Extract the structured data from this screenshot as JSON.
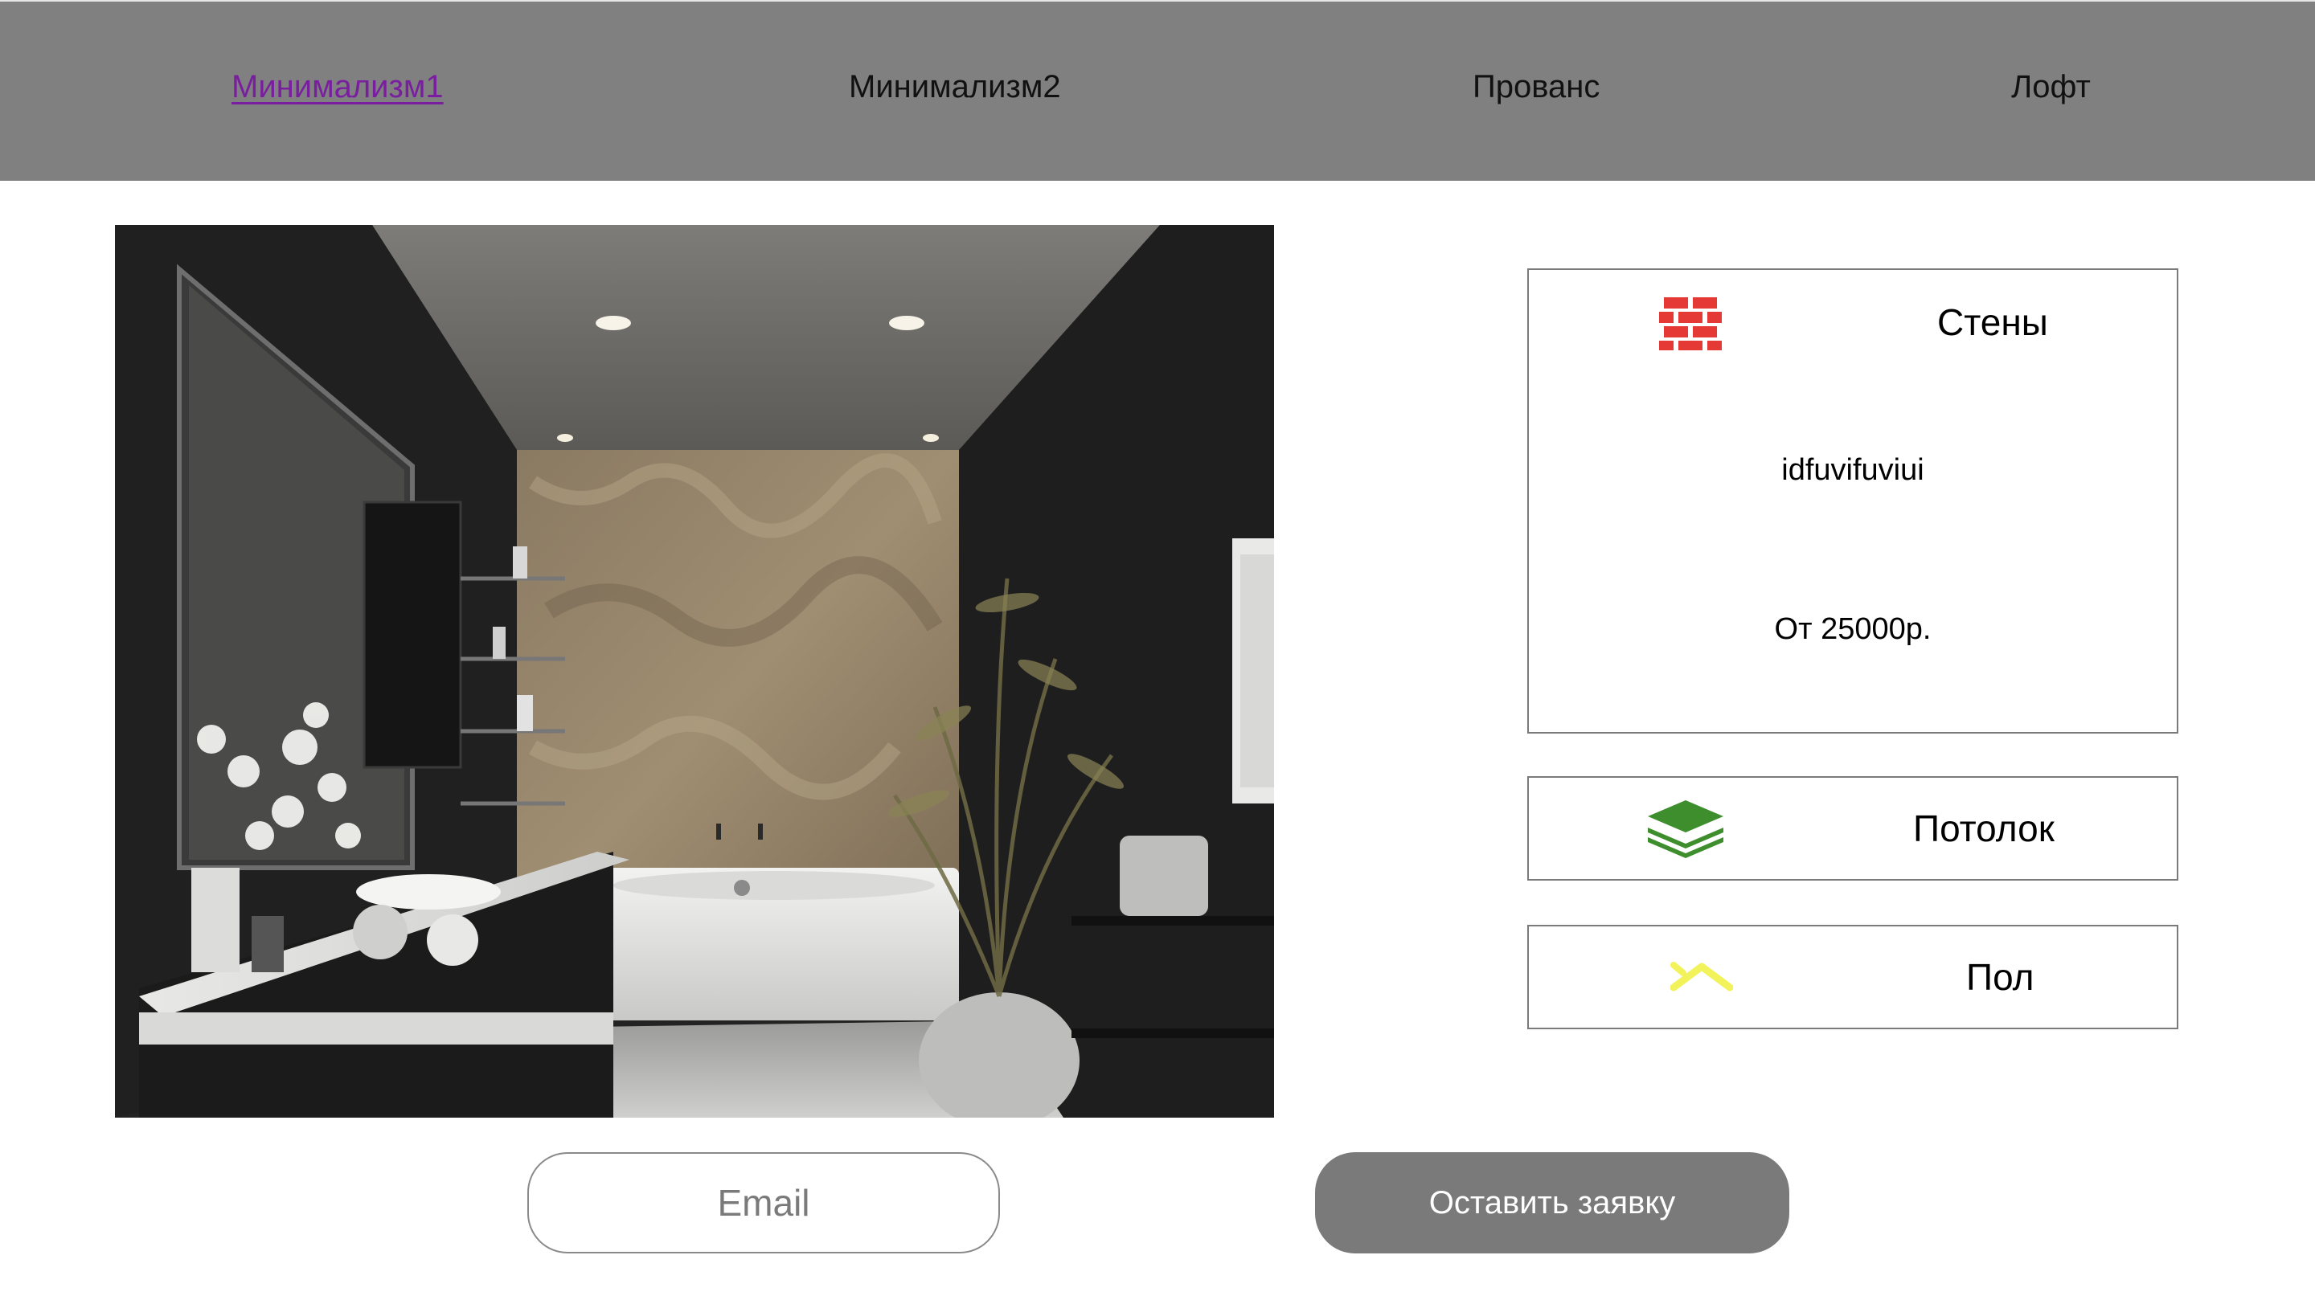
{
  "nav": {
    "items": [
      {
        "label": "Минимализм1",
        "active": true
      },
      {
        "label": "Минимализм2",
        "active": false
      },
      {
        "label": "Прованс",
        "active": false
      },
      {
        "label": "Лофт",
        "active": false
      }
    ]
  },
  "hero": {
    "image": "bathroom-interior-photo"
  },
  "cards": {
    "walls": {
      "title": "Стены",
      "icon": "brick-wall-icon",
      "description": "idfuvifuviui",
      "price": "От 25000р."
    },
    "ceiling": {
      "title": "Потолок",
      "icon": "layers-icon"
    },
    "floor": {
      "title": "Пол",
      "icon": "chevron-up-icon"
    }
  },
  "form": {
    "email_placeholder": "Email",
    "submit_label": "Оставить заявку"
  },
  "colors": {
    "nav_background": "#808080",
    "active_link": "#7a1ea0",
    "brick_icon": "#e53935",
    "layers_icon": "#3f8e2e",
    "floor_icon": "#f2f25a",
    "button": "#7a7a7a"
  }
}
